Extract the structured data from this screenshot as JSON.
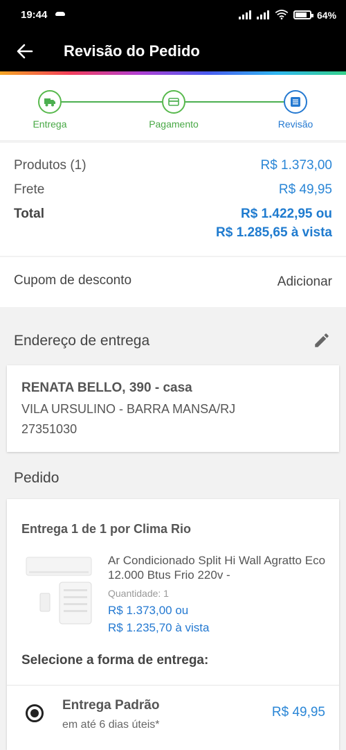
{
  "status": {
    "time": "19:44",
    "battery": "64%"
  },
  "appbar": {
    "title": "Revisão do Pedido"
  },
  "steps": [
    {
      "label": "Entrega",
      "icon": "truck-icon"
    },
    {
      "label": "Pagamento",
      "icon": "card-icon"
    },
    {
      "label": "Revisão",
      "icon": "list-icon"
    }
  ],
  "summary": {
    "produtos_label": "Produtos (1)",
    "produtos_value": "R$ 1.373,00",
    "frete_label": "Frete",
    "frete_value": "R$ 49,95",
    "total_label": "Total",
    "total_value_1": "R$ 1.422,95 ou",
    "total_value_2": "R$ 1.285,65 à vista"
  },
  "coupon": {
    "label": "Cupom de desconto",
    "action": "Adicionar"
  },
  "address": {
    "section_title": "Endereço de entrega",
    "line1": "RENATA BELLO, 390 - casa",
    "line2": "VILA URSULINO - BARRA MANSA/RJ",
    "line3": "27351030"
  },
  "order": {
    "section_title": "Pedido",
    "seller": "Entrega 1 de 1 por Clima Rio",
    "product_name": "Ar Condicionado Split Hi Wall  Agratto Eco  12.000 Btus Frio 220v -",
    "quantity": "Quantidade:  1",
    "price_1": "R$ 1.373,00 ou",
    "price_2": "R$ 1.235,70 à vista",
    "choose_label": "Selecione a forma de entrega:",
    "shipping": {
      "name": "Entrega Padrão",
      "eta": "em até 6 dias úteis*",
      "price": "R$ 49,95"
    }
  },
  "colors": {
    "accent_blue": "#2479d1",
    "step_green": "#4caf50"
  }
}
